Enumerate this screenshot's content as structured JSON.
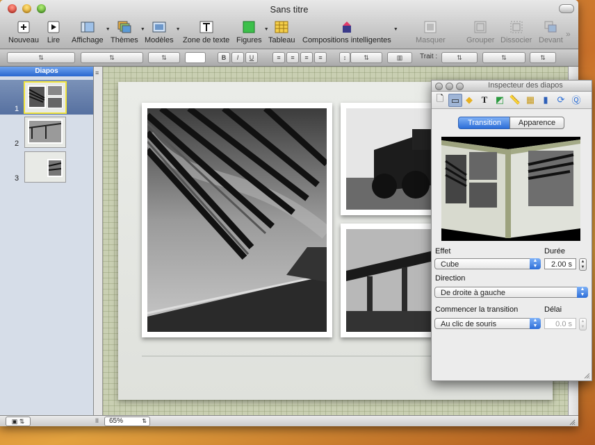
{
  "window": {
    "title": "Sans titre"
  },
  "toolbar": {
    "nouveau": "Nouveau",
    "lire": "Lire",
    "affichage": "Affichage",
    "themes": "Thèmes",
    "modeles": "Modèles",
    "zone_texte": "Zone de texte",
    "figures": "Figures",
    "tableau": "Tableau",
    "compositions": "Compositions intelligentes",
    "masquer": "Masquer",
    "grouper": "Grouper",
    "dissocier": "Dissocier",
    "devant": "Devant"
  },
  "formatbar": {
    "bold": "B",
    "italic": "I",
    "underline": "U",
    "trait_label": "Trait :"
  },
  "sidebar": {
    "header": "Diapos",
    "slides": [
      {
        "num": "1"
      },
      {
        "num": "2"
      },
      {
        "num": "3"
      }
    ]
  },
  "bottombar": {
    "zoom": "65%"
  },
  "inspector": {
    "title": "Inspecteur des diapos",
    "tab_transition": "Transition",
    "tab_apparence": "Apparence",
    "effet_label": "Effet",
    "effet_value": "Cube",
    "duree_label": "Durée",
    "duree_value": "2.00 s",
    "direction_label": "Direction",
    "direction_value": "De droite à gauche",
    "commencer_label": "Commencer la transition",
    "commencer_value": "Au clic de souris",
    "delai_label": "Délai",
    "delai_value": "0.0 s"
  },
  "colors": {
    "accent": "#2c6ed8",
    "selection_border": "#f2e53c",
    "canvas_grid": "#c9cfb2"
  }
}
